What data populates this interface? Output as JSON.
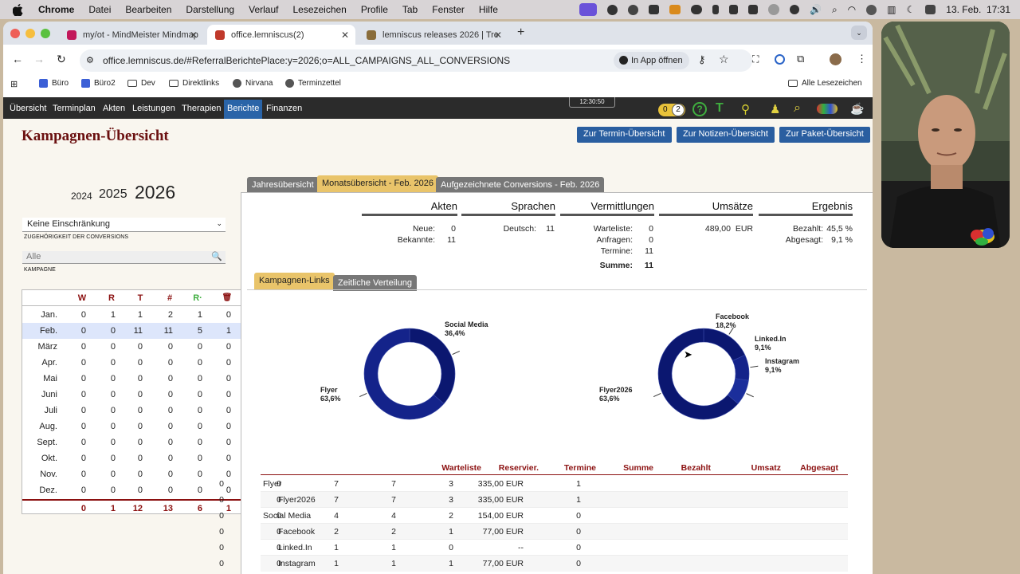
{
  "macos": {
    "menu": [
      "Chrome",
      "Datei",
      "Bearbeiten",
      "Darstellung",
      "Verlauf",
      "Lesezeichen",
      "Profile",
      "Tab",
      "Fenster",
      "Hilfe"
    ],
    "datetime": "13. Feb.  17:31"
  },
  "browser": {
    "tabs": [
      {
        "title": "my/ot - MindMeister Mindmap",
        "color": "#c2185b"
      },
      {
        "title": "office.lemniscus(2)",
        "color": "#c0392b"
      },
      {
        "title": "lemniscus releases 2026 | Tre",
        "color": "#8a6d3b"
      }
    ],
    "url": "office.lemniscus.de/#ReferralBerichtePlace:y=2026;o=ALL_CAMPAIGNS_ALL_CONVERSIONS",
    "open_in_app": "In App öffnen",
    "bookmarks": [
      "Büro",
      "Büro2",
      "Dev",
      "Direktlinks",
      "Nirvana",
      "Terminzettel"
    ],
    "all_bookmarks": "Alle Lesezeichen"
  },
  "app": {
    "nav": [
      "Übersicht",
      "Terminplan",
      "Akten",
      "Leistungen",
      "Therapien",
      "Berichte",
      "Finanzen"
    ],
    "active_nav": "Berichte",
    "clock": "12:30:50",
    "badge_left": "0",
    "badge_right": "2",
    "title": "Kampagnen-Übersicht",
    "buttons": [
      "Zur Termin-Übersicht",
      "Zur Notizen-Übersicht",
      "Zur Paket-Übersicht"
    ],
    "years": [
      "2024",
      "2025",
      "2026"
    ],
    "filter_value": "Keine Einschränkung",
    "filter_caption": "ZUGEHÖRIGKEIT DER CONVERSIONS",
    "search_placeholder": "Alle",
    "search_caption": "KAMPAGNE",
    "month_table": {
      "headers": [
        "W",
        "R",
        "T",
        "#",
        "R·",
        "🗑"
      ],
      "rows": [
        {
          "m": "Jan.",
          "v": [
            "0",
            "1",
            "1",
            "2",
            "1",
            "0"
          ]
        },
        {
          "m": "Feb.",
          "v": [
            "0",
            "0",
            "11",
            "11",
            "5",
            "1"
          ]
        },
        {
          "m": "März",
          "v": [
            "0",
            "0",
            "0",
            "0",
            "0",
            "0"
          ]
        },
        {
          "m": "Apr.",
          "v": [
            "0",
            "0",
            "0",
            "0",
            "0",
            "0"
          ]
        },
        {
          "m": "Mai",
          "v": [
            "0",
            "0",
            "0",
            "0",
            "0",
            "0"
          ]
        },
        {
          "m": "Juni",
          "v": [
            "0",
            "0",
            "0",
            "0",
            "0",
            "0"
          ]
        },
        {
          "m": "Juli",
          "v": [
            "0",
            "0",
            "0",
            "0",
            "0",
            "0"
          ]
        },
        {
          "m": "Aug.",
          "v": [
            "0",
            "0",
            "0",
            "0",
            "0",
            "0"
          ]
        },
        {
          "m": "Sept.",
          "v": [
            "0",
            "0",
            "0",
            "0",
            "0",
            "0"
          ]
        },
        {
          "m": "Okt.",
          "v": [
            "0",
            "0",
            "0",
            "0",
            "0",
            "0"
          ]
        },
        {
          "m": "Nov.",
          "v": [
            "0",
            "0",
            "0",
            "0",
            "0",
            "0"
          ]
        },
        {
          "m": "Dez.",
          "v": [
            "0",
            "0",
            "0",
            "0",
            "0",
            "0"
          ]
        }
      ],
      "totals": [
        "0",
        "1",
        "12",
        "13",
        "6",
        "1"
      ]
    },
    "panel_tabs": [
      "Jahresübersicht",
      "Monatsübersicht - Feb. 2026",
      "Aufgezeichnete Conversions - Feb. 2026"
    ],
    "summary": {
      "akten": {
        "title": "Akten",
        "neue_label": "Neue:",
        "neue": "0",
        "bekannte_label": "Bekannte:",
        "bekannte": "11"
      },
      "sprachen": {
        "title": "Sprachen",
        "deutsch_label": "Deutsch:",
        "deutsch": "11"
      },
      "vermittlungen": {
        "title": "Vermittlungen",
        "warteliste_label": "Warteliste:",
        "warteliste": "0",
        "anfragen_label": "Anfragen:",
        "anfragen": "0",
        "termine_label": "Termine:",
        "termine": "11",
        "summe_label": "Summe:",
        "summe": "11"
      },
      "umsaetze": {
        "title": "Umsätze",
        "value": "489,00  EUR"
      },
      "ergebnis": {
        "title": "Ergebnis",
        "bezahlt_label": "Bezahlt:",
        "bezahlt": "45,5 %",
        "abgesagt_label": "Abgesagt:",
        "abgesagt": "9,1 %"
      }
    },
    "sub_tabs": [
      "Kampagnen-Links",
      "Zeitliche Verteilung"
    ],
    "donut_left": [
      {
        "label": "Social Media",
        "pct": "36,4%",
        "value": 36.4
      },
      {
        "label": "Flyer",
        "pct": "63,6%",
        "value": 63.6
      }
    ],
    "donut_right": [
      {
        "label": "Facebook",
        "pct": "18,2%",
        "value": 18.2
      },
      {
        "label": "Linked.In",
        "pct": "9,1%",
        "value": 9.1
      },
      {
        "label": "Instagram",
        "pct": "9,1%",
        "value": 9.1
      },
      {
        "label": "Flyer2026",
        "pct": "63,6%",
        "value": 63.6
      }
    ],
    "table": {
      "headers": [
        "Warteliste",
        "Reservier.",
        "Termine",
        "Summe",
        "Bezahlt",
        "Umsatz",
        "Abgesagt"
      ],
      "rows": [
        {
          "name": "Flyer",
          "indent": false,
          "v": [
            "0",
            "0",
            "7",
            "7",
            "3",
            "335,00 EUR",
            "1"
          ]
        },
        {
          "name": "Flyer2026",
          "indent": true,
          "v": [
            "0",
            "0",
            "7",
            "7",
            "3",
            "335,00 EUR",
            "1"
          ]
        },
        {
          "name": "Social Media",
          "indent": false,
          "v": [
            "0",
            "0",
            "4",
            "4",
            "2",
            "154,00 EUR",
            "0"
          ]
        },
        {
          "name": "Facebook",
          "indent": true,
          "v": [
            "0",
            "0",
            "2",
            "2",
            "1",
            "77,00 EUR",
            "0"
          ]
        },
        {
          "name": "Linked.In",
          "indent": true,
          "v": [
            "0",
            "0",
            "1",
            "1",
            "0",
            "--",
            "0"
          ]
        },
        {
          "name": "Instagram",
          "indent": true,
          "v": [
            "0",
            "0",
            "1",
            "1",
            "1",
            "77,00 EUR",
            "0"
          ]
        }
      ]
    }
  },
  "colors": {
    "accent": "#2a5ea0",
    "title": "#6b1010",
    "header_red": "#8b1010",
    "donut": "#0b1770",
    "tab_active": "#e9c46a"
  }
}
